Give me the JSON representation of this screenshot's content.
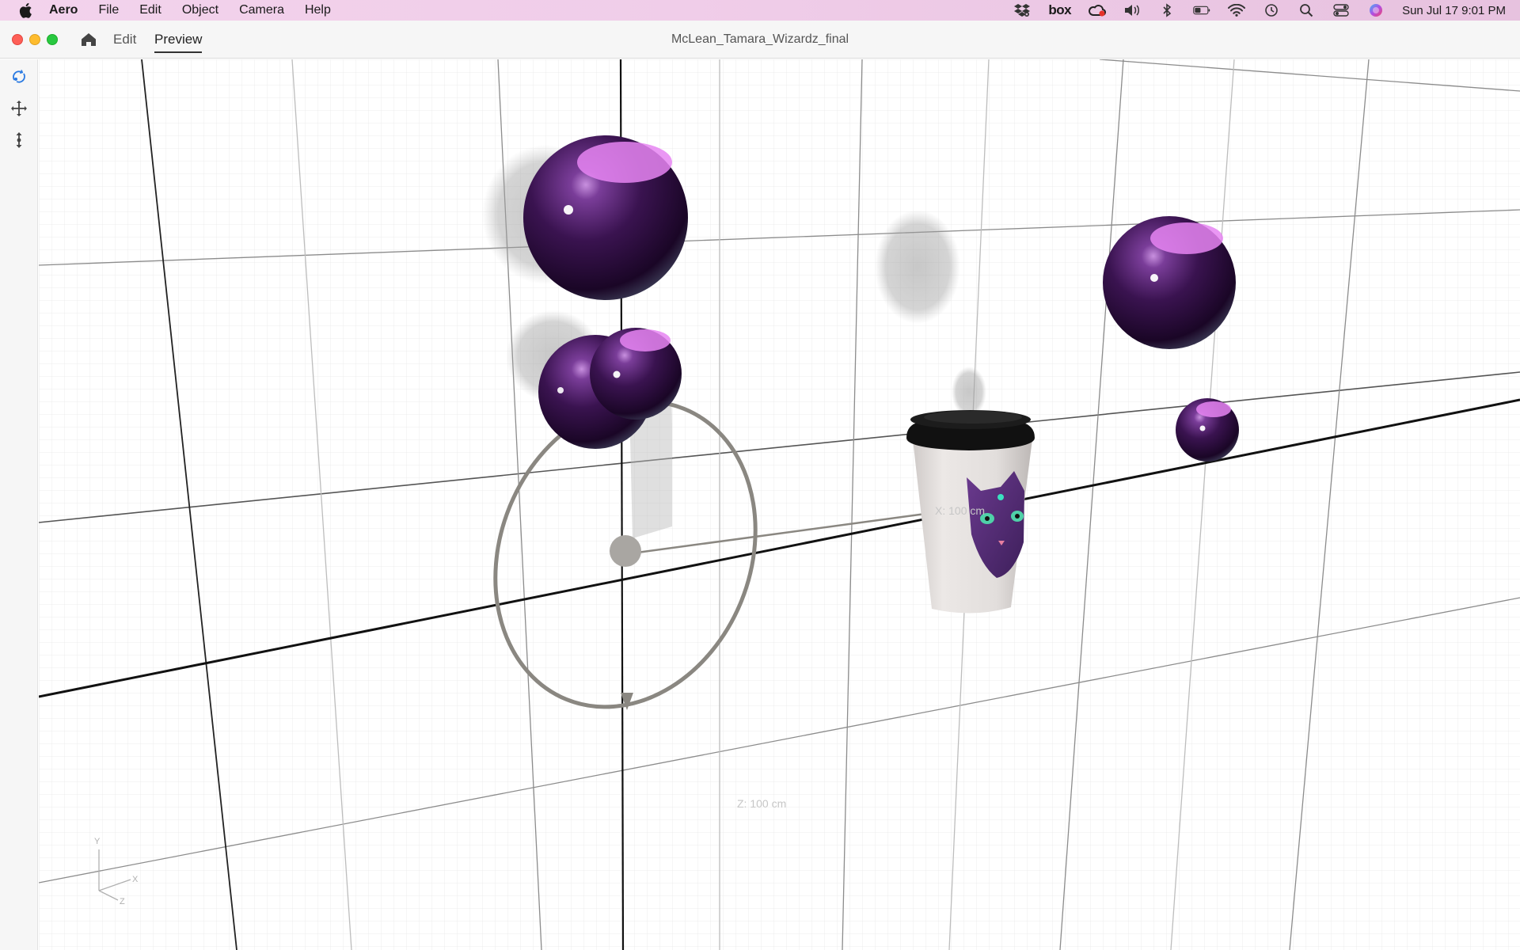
{
  "menubar": {
    "app_name": "Aero",
    "items": [
      "File",
      "Edit",
      "Object",
      "Camera",
      "Help"
    ],
    "box_label": "box",
    "clock": "Sun Jul 17  9:01 PM"
  },
  "window": {
    "title": "McLean_Tamara_Wizardz_final",
    "tabs": {
      "edit": "Edit",
      "preview": "Preview"
    },
    "active_tab": "Preview"
  },
  "toolbar": {
    "tools": [
      "rotate-tool-icon",
      "move-tool-icon",
      "vertical-move-tool-icon"
    ],
    "active_tool": "rotate-tool-icon"
  },
  "viewport": {
    "x_dimension_label": "X: 100 cm",
    "z_dimension_label": "Z: 100 cm",
    "axis_gizmo": {
      "y": "Y",
      "x": "X",
      "z": "Z"
    }
  },
  "colors": {
    "sphere": "#3a1350",
    "sphere_highlight": "#e685f2",
    "gizmo": "#8a8781",
    "menubar_tint": "#f0cde9",
    "active_tool": "#2a7ae2"
  }
}
